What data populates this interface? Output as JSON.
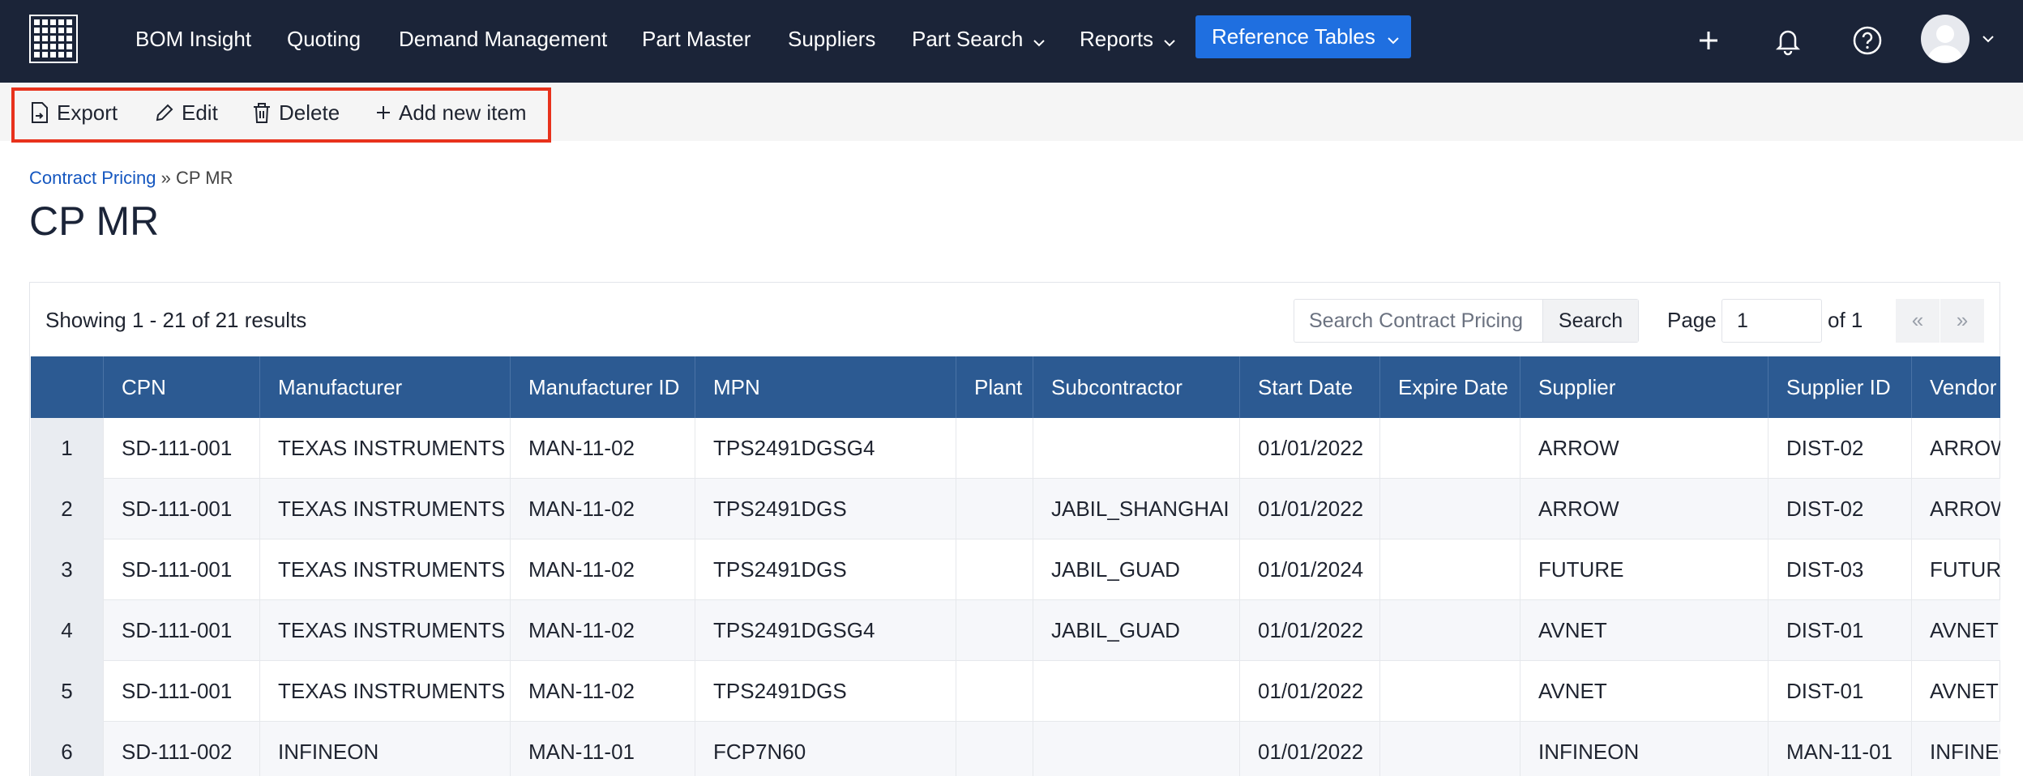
{
  "nav": {
    "items": [
      {
        "label": "BOM Insight"
      },
      {
        "label": "Quoting"
      },
      {
        "label": "Demand Management"
      },
      {
        "label": "Part Master"
      },
      {
        "label": "Suppliers"
      },
      {
        "label": "Part Search"
      },
      {
        "label": "Reports"
      }
    ],
    "active": {
      "label": "Reference Tables"
    },
    "icons": [
      "plus-icon",
      "bell-icon",
      "help-icon",
      "avatar",
      "chevron-down-icon"
    ]
  },
  "toolbar": {
    "export": "Export",
    "edit": "Edit",
    "delete": "Delete",
    "add": "Add new item",
    "highlight_color": "#e8321c"
  },
  "breadcrumb": {
    "parent": "Contract Pricing",
    "separator": "»",
    "current": "CP MR"
  },
  "page": {
    "title": "CP MR"
  },
  "results": {
    "showing": "Showing 1 - 21 of 21 results",
    "search_placeholder": "Search Contract Pricing",
    "search_button": "Search",
    "page_label": "Page",
    "page_value": "1",
    "page_of": "of 1",
    "prev": "«",
    "next": "»"
  },
  "table": {
    "columns": [
      "",
      "CPN",
      "Manufacturer",
      "Manufacturer ID",
      "MPN",
      "Plant",
      "Subcontractor",
      "Start Date",
      "Expire Date",
      "Supplier",
      "Supplier ID",
      "Vendor"
    ],
    "rows": [
      [
        "1",
        "SD-111-001",
        "TEXAS INSTRUMENTS",
        "MAN-11-02",
        "TPS2491DGSG4",
        "",
        "",
        "01/01/2022",
        "",
        "ARROW",
        "DIST-02",
        "ARROW"
      ],
      [
        "2",
        "SD-111-001",
        "TEXAS INSTRUMENTS",
        "MAN-11-02",
        "TPS2491DGS",
        "",
        "JABIL_SHANGHAI",
        "01/01/2022",
        "",
        "ARROW",
        "DIST-02",
        "ARROW"
      ],
      [
        "3",
        "SD-111-001",
        "TEXAS INSTRUMENTS",
        "MAN-11-02",
        "TPS2491DGS",
        "",
        "JABIL_GUAD",
        "01/01/2024",
        "",
        "FUTURE",
        "DIST-03",
        "FUTURE"
      ],
      [
        "4",
        "SD-111-001",
        "TEXAS INSTRUMENTS",
        "MAN-11-02",
        "TPS2491DGSG4",
        "",
        "JABIL_GUAD",
        "01/01/2022",
        "",
        "AVNET",
        "DIST-01",
        "AVNET"
      ],
      [
        "5",
        "SD-111-001",
        "TEXAS INSTRUMENTS",
        "MAN-11-02",
        "TPS2491DGS",
        "",
        "",
        "01/01/2022",
        "",
        "AVNET",
        "DIST-01",
        "AVNET"
      ],
      [
        "6",
        "SD-111-002",
        "INFINEON",
        "MAN-11-01",
        "FCP7N60",
        "",
        "",
        "01/01/2022",
        "",
        "INFINEON",
        "MAN-11-01",
        "INFINEON"
      ]
    ]
  },
  "colors": {
    "nav_bg": "#1b2438",
    "nav_active": "#1f6fe0",
    "table_header": "#2c5a92",
    "link": "#1557c0"
  }
}
